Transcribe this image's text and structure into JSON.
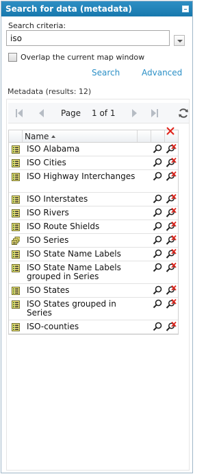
{
  "panel": {
    "title": "Search for data (metadata)"
  },
  "search": {
    "criteria_label": "Search criteria:",
    "value": "iso",
    "overlap_label": "Overlap the current map window",
    "search_link": "Search",
    "advanced_link": "Advanced"
  },
  "results": {
    "label": "Metadata (results: 12)",
    "pager": {
      "page_word": "Page",
      "page_value": "1 of 1"
    },
    "columns": {
      "name": "Name"
    },
    "rows": [
      {
        "name": "ISO Alabama",
        "icon": "metadata-doc-icon"
      },
      {
        "name": "ISO Cities",
        "icon": "metadata-doc-icon"
      },
      {
        "name": "ISO Highway Interchanges",
        "icon": "metadata-doc-icon"
      },
      {
        "name": "ISO Interstates",
        "icon": "metadata-doc-icon"
      },
      {
        "name": "ISO Rivers",
        "icon": "metadata-doc-icon"
      },
      {
        "name": "ISO Route Shields",
        "icon": "metadata-doc-icon"
      },
      {
        "name": "ISO Series",
        "icon": "metadata-series-icon"
      },
      {
        "name": "ISO State Name Labels",
        "icon": "metadata-doc-icon"
      },
      {
        "name": "ISO State Name Labels grouped in Series",
        "icon": "metadata-doc-icon"
      },
      {
        "name": "ISO States",
        "icon": "metadata-doc-icon"
      },
      {
        "name": "ISO States grouped in Series",
        "icon": "metadata-doc-icon"
      },
      {
        "name": "ISO-counties",
        "icon": "metadata-doc-icon"
      }
    ]
  },
  "colors": {
    "title_bar": "#1778ad",
    "link": "#2a8fc6",
    "remove_red": "#e0231b"
  }
}
